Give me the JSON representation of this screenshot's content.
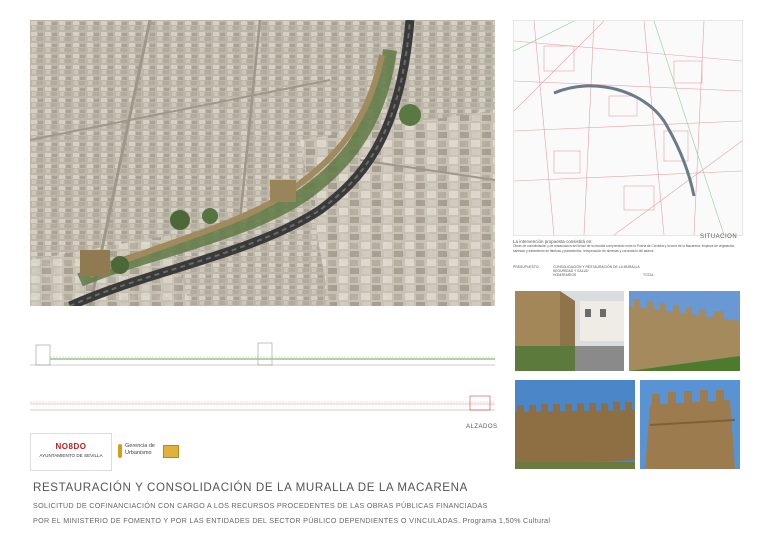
{
  "aerial_image": {
    "name": "aerial-view-muralla"
  },
  "map": {
    "label": "SITUACION"
  },
  "description": {
    "heading": "La intervención propuesta consistirá en:",
    "body": "Obras de consolidación y de restauración del lienzo de la muralla comprendido entre la Puerta de Córdoba y la torre de la Macarena; limpieza de vegetación, saneado y tratamiento de fábricas y paramentos, recuperación de almenas y coronación del adarve.",
    "budget_label": "PRESUPUESTO:",
    "budget_lines": [
      "CONSOLIDACIÓN Y RESTAURACIÓN DE LA MURALLA",
      "SEGURIDAD Y SALUD",
      "HONORARIOS"
    ],
    "total_label": "TOTAL:"
  },
  "elevations": {
    "label": "ALZADOS"
  },
  "logos": {
    "nodo": "NO8DO",
    "ayto": "AYUNTAMIENTO DE SEVILLA",
    "gerencia_line1": "Gerencia de",
    "gerencia_line2": "Urbanismo"
  },
  "footer": {
    "title": "RESTAURACIÓN Y CONSOLIDACIÓN DE LA MURALLA DE LA MACARENA",
    "line1": "SOLICITUD DE COFINANCIACIÓN CON CARGO A LOS RECURSOS PROCEDENTES DE LAS OBRAS PÚBLICAS FINANCIADAS",
    "line2": "POR EL MINISTERIO DE FOMENTO Y POR LAS ENTIDADES DEL SECTOR PÚBLICO DEPENDIENTES O VINCULADAS.  Programa 1,50% Cultural"
  },
  "colors": {
    "wall": "#a08a5e",
    "greenery": "#5f7a45",
    "sky": "#4f87c9",
    "map_route": "#6b7a8a"
  }
}
